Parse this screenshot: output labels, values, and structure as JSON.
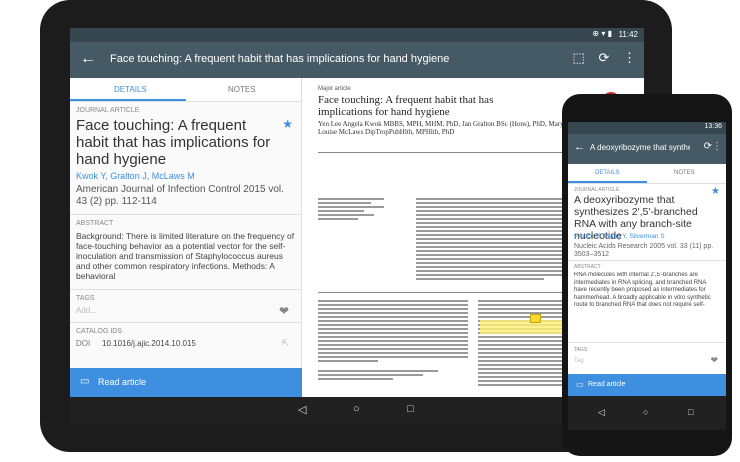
{
  "tablet": {
    "status": {
      "time": "11:42",
      "icons": "⊕ ▾ ▮"
    },
    "appbar": {
      "title": "Face touching: A frequent habit that has implications for hand hygiene"
    },
    "tabs": [
      "DETAILS",
      "NOTES"
    ],
    "details": {
      "section_label": "JOURNAL ARTICLE",
      "title": "Face touching: A frequent habit that has implications for hand hygiene",
      "authors": "Kwok Y, Gralton J, McLaws M",
      "journal": "American Journal of Infection Control 2015 vol. 43 (2) pp. 112-114",
      "abstract_label": "ABSTRACT",
      "abstract": "Background: There is limited literature on the frequency of face-touching behavior as a potential vector for the self-inoculation and transmission of Staphylococcus aureus and other common respiratory infections. Methods: A behavioral",
      "tags_label": "TAGS",
      "tags_placeholder": "Add...",
      "catalog_label": "CATALOG IDS",
      "doi_key": "DOI",
      "doi_value": "10.1016/j.ajic.2014.10.015",
      "read_label": "Read article"
    },
    "pdf": {
      "kicker": "Major article",
      "title": "Face touching: A frequent habit that has implications for hand hygiene",
      "authors": "Yen Lee Angela Kwok MBBS, MPH, MHM, PhD, Jan Gralton BSc (Hons), PhD, Mary-Louise McLaws DipTropPubHlth, MPHlth, PhD"
    }
  },
  "phone": {
    "status": {
      "time": "13:36"
    },
    "appbar": {
      "title": "A deoxyribozyme that synthes..."
    },
    "tabs": [
      "DETAILS",
      "NOTES"
    ],
    "details": {
      "section_label": "JOURNAL ARTICLE",
      "title": "A deoxyribozyme that synthesizes 2',5'-branched RNA with any branch-site nucleotide",
      "authors": "Pratico E, Wang Y, Silverman S",
      "journal": "Nucleic Acids Research 2005 vol. 33 (11) pp. 3503–3512",
      "abstract_label": "ABSTRACT",
      "abstract": "RNA molecules with internal 2',5'-branches are intermediates in RNA splicing, and branched RNA have recently been proposed as intermediates for hammerhead. A broadly applicable in vitro synthetic route to branched RNA that does not require self-",
      "tags_label": "TAGS",
      "tags_placeholder": "Tag",
      "read_label": "Read article"
    }
  },
  "icons": {
    "back": "←",
    "sync": "⟳",
    "more": "⋮",
    "fullscreen": "⬚",
    "star": "★",
    "tag": "❤",
    "open_external": "⇱",
    "book": "▭",
    "nav_back": "◁",
    "nav_home": "○",
    "nav_recent": "□"
  },
  "colors": {
    "accent": "#3f8fe0",
    "appbar": "#455a64",
    "statusbar": "#37474f",
    "navbar": "#212121"
  }
}
